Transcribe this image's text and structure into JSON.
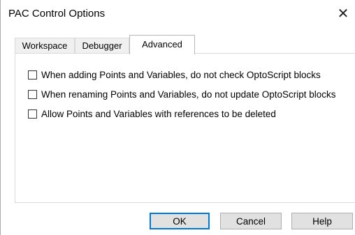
{
  "window": {
    "title": "PAC Control Options",
    "close_glyph": "✕"
  },
  "tabs": [
    {
      "label": "Workspace",
      "active": false
    },
    {
      "label": "Debugger",
      "active": false
    },
    {
      "label": "Advanced",
      "active": true
    }
  ],
  "options": [
    {
      "label": "When adding Points and Variables, do not check OptoScript blocks",
      "checked": false
    },
    {
      "label": "When renaming Points and Variables, do not update OptoScript blocks",
      "checked": false
    },
    {
      "label": "Allow Points and Variables with references to be deleted",
      "checked": false
    }
  ],
  "buttons": {
    "ok": "OK",
    "cancel": "Cancel",
    "help": "Help"
  },
  "colors": {
    "default_button_border": "#0078d7",
    "button_face": "#e1e1e1"
  },
  "icons": {
    "close": "close-icon"
  }
}
